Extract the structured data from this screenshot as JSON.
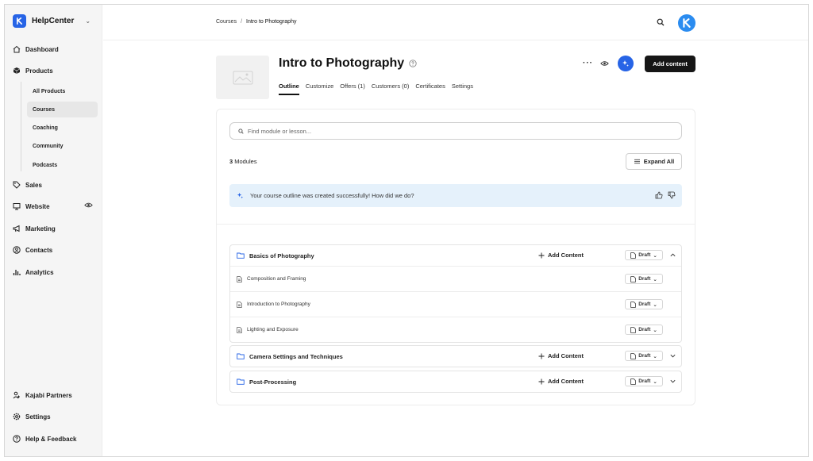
{
  "sidebar": {
    "brand": "HelpCenter",
    "items": {
      "dashboard": "Dashboard",
      "products": "Products",
      "sales": "Sales",
      "website": "Website",
      "marketing": "Marketing",
      "contacts": "Contacts",
      "analytics": "Analytics"
    },
    "products_sub": [
      "All Products",
      "Courses",
      "Coaching",
      "Community",
      "Podcasts"
    ],
    "active_sub": "Courses",
    "bottom": {
      "partners": "Kajabi Partners",
      "settings": "Settings",
      "help": "Help & Feedback"
    }
  },
  "header": {
    "breadcrumb": [
      "Courses",
      "/",
      "Intro to Photography"
    ]
  },
  "course": {
    "title": "Intro to Photography",
    "tabs": [
      "Outline",
      "Customize",
      "Offers (1)",
      "Customers (0)",
      "Certificates",
      "Settings"
    ],
    "active_tab": "Outline",
    "more": "···",
    "add_content": "Add content"
  },
  "outline": {
    "search_placeholder": "Find module or lesson...",
    "module_count_num": "3",
    "module_count_label": " Modules",
    "expand_all": "Expand All",
    "banner": "Your course outline was created successfully! How did we do?",
    "add_content_label": "Add Content",
    "draft_label": "Draft",
    "modules": [
      {
        "name": "Basics of Photography",
        "expanded": true,
        "lessons": [
          "Composition and Framing",
          "Introduction to Photography",
          "Lighting and Exposure"
        ]
      },
      {
        "name": "Camera Settings and Techniques",
        "expanded": false,
        "lessons": []
      },
      {
        "name": "Post-Processing",
        "expanded": false,
        "lessons": []
      }
    ]
  },
  "colors": {
    "accent": "#2764e6",
    "avatar": "#2b8cf0",
    "banner_bg": "#e5f1fb",
    "primary_button": "#161616"
  }
}
